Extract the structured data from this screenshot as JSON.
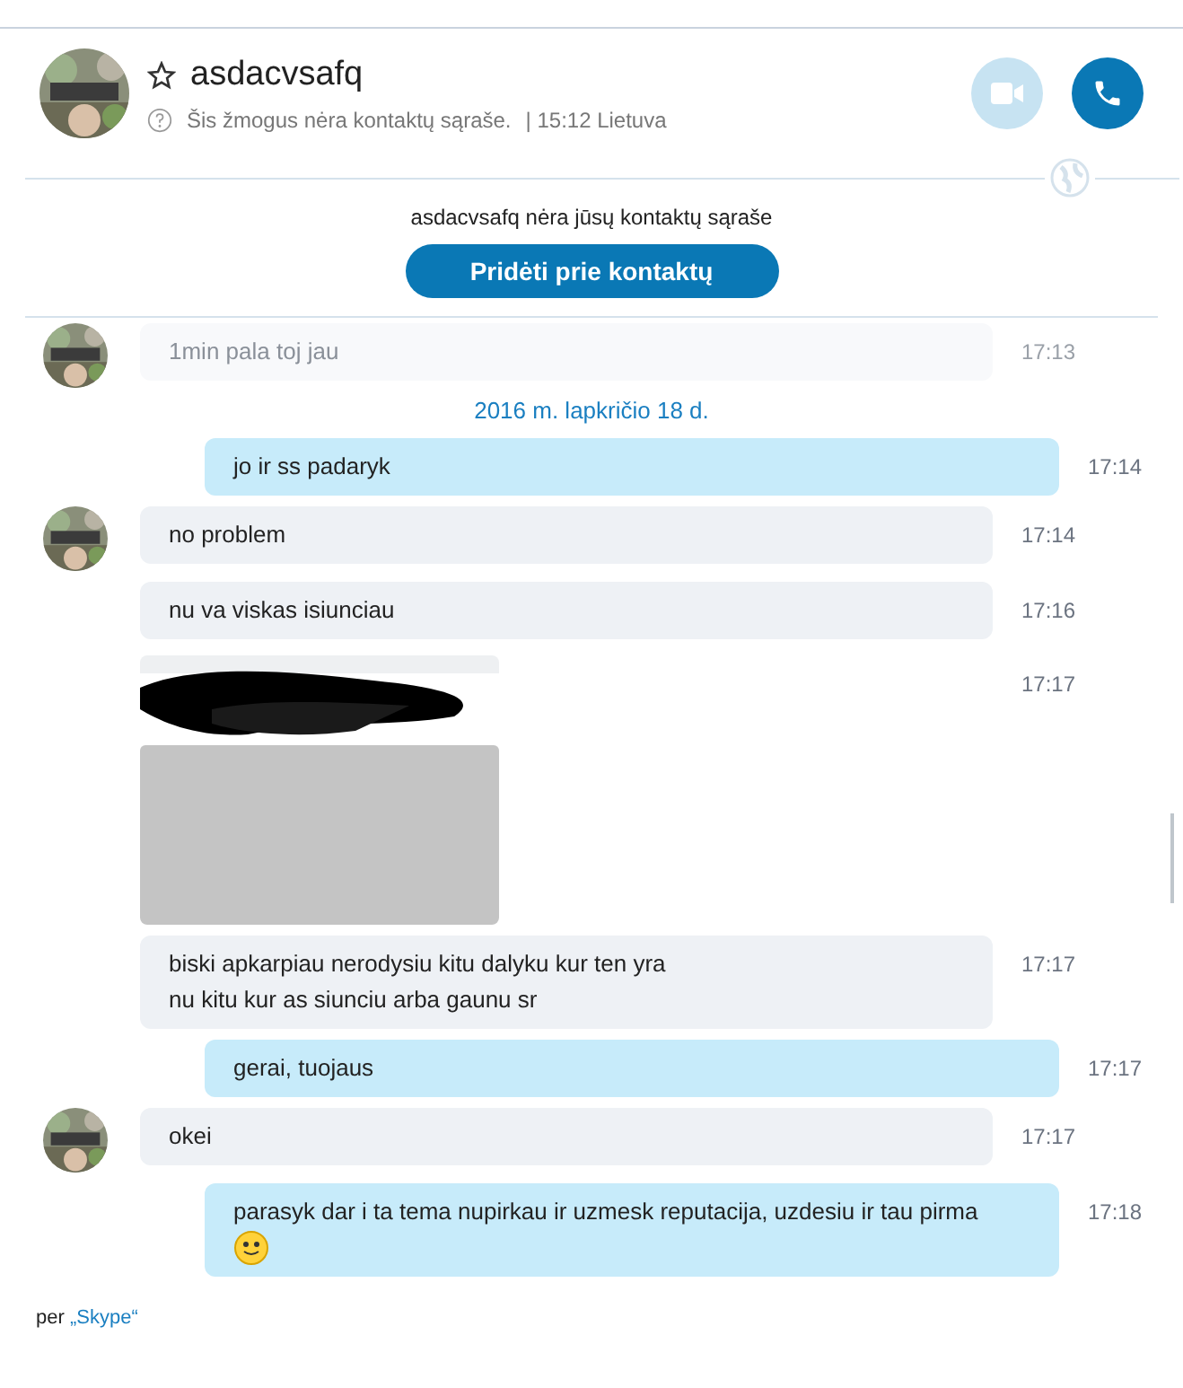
{
  "header": {
    "name": "asdacvsafq",
    "favorite": false,
    "status": "Šis žmogus nėra kontaktų sąraše.",
    "local_time": "| 15:12 Lietuva",
    "video_enabled": false
  },
  "notice": {
    "text": "asdacvsafq nėra jūsų kontaktų sąraše",
    "button": "Pridėti prie kontaktų"
  },
  "faded_message": {
    "lines": [
      "1min pala toj jau"
    ],
    "time": "17:13"
  },
  "date_divider": "2016 m. lapkričio 18 d.",
  "messages": [
    {
      "kind": "outgoing",
      "lines": [
        "jo ir ss padaryk"
      ],
      "emoji": false,
      "time": "17:14"
    },
    {
      "kind": "incoming",
      "avatar": true,
      "lines": [
        "no problem"
      ],
      "time": "17:14"
    },
    {
      "kind": "incoming",
      "avatar": false,
      "lines": [
        "nu va viskas isiunciau"
      ],
      "time": "17:16"
    },
    {
      "time": "17:17"
    },
    {
      "kind": "incoming",
      "avatar": false,
      "lines": [
        "biski apkarpiau nerodysiu kitu dalyku kur ten yra",
        "nu kitu kur as siunciu arba gaunu sr"
      ],
      "time": "17:17"
    },
    {
      "kind": "outgoing",
      "lines": [
        "gerai, tuojaus"
      ],
      "emoji": false,
      "time": "17:17"
    },
    {
      "kind": "incoming",
      "avatar": true,
      "lines": [
        "okei"
      ],
      "time": "17:17"
    },
    {
      "kind": "outgoing",
      "lines": [
        "parasyk dar i ta tema nupirkau ir uzmesk reputacija, uzdesiu ir tau pirma"
      ],
      "emoji": true,
      "time": "17:18"
    }
  ],
  "footer": {
    "prefix": "per",
    "link": "„Skype“"
  }
}
